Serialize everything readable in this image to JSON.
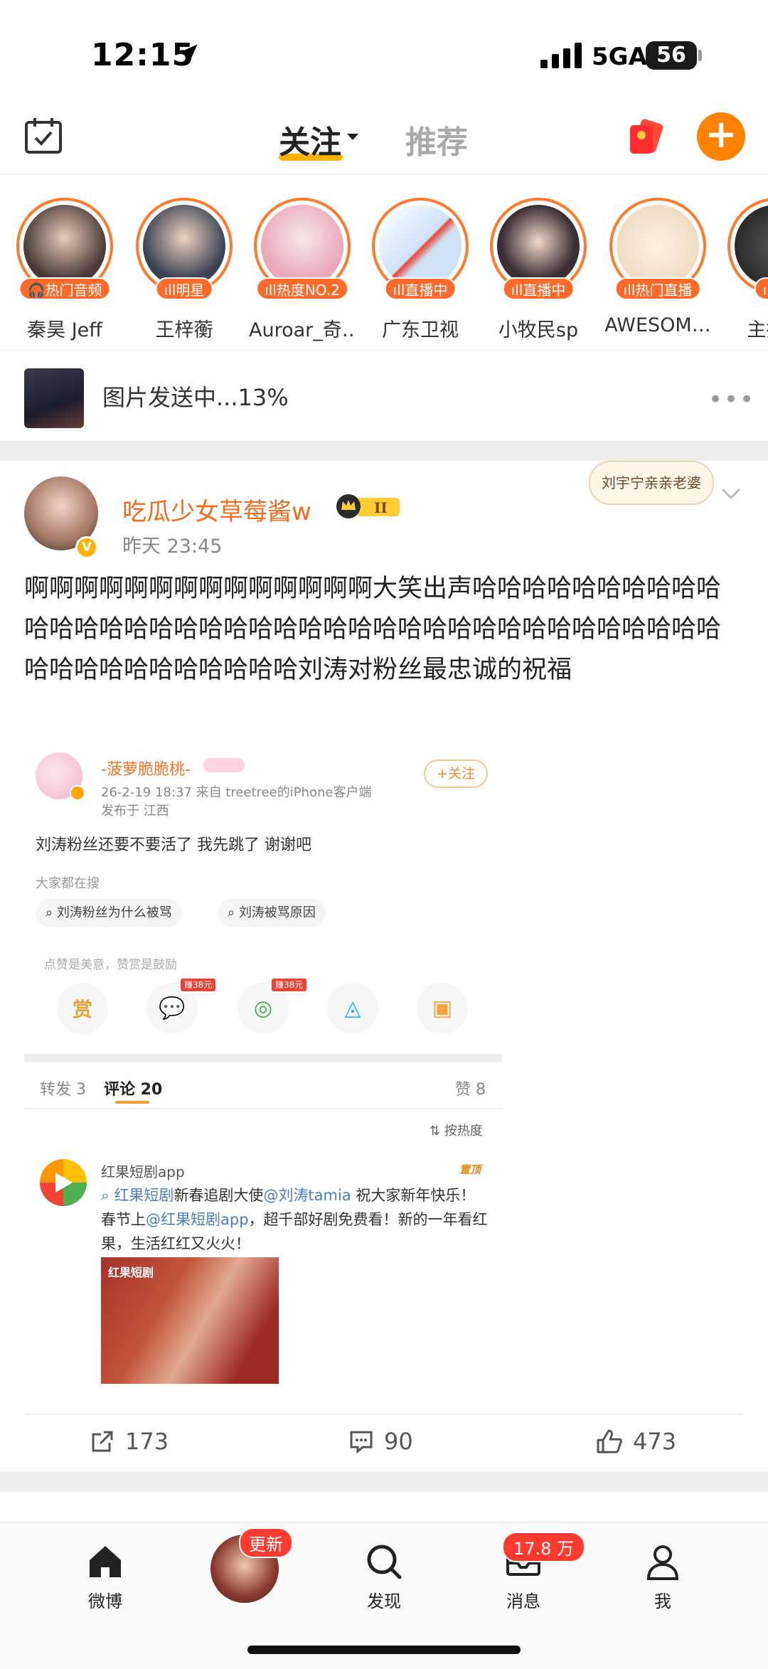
{
  "status_bar": {
    "time": "12:15",
    "network": "5GA",
    "battery": "56"
  },
  "top_nav": {
    "tab_follow": "关注",
    "tab_recommend": "推荐"
  },
  "stories": [
    {
      "name": "秦昊 Jeff",
      "badge": "🎧热门音频",
      "color": "#4a3a3a"
    },
    {
      "name": "王梓蘅",
      "badge": "ıll明星",
      "color": "#3b4250"
    },
    {
      "name": "Auroar_奇…",
      "badge": "ıll热度NO.2",
      "color": "#e9c0cc"
    },
    {
      "name": "广东卫视",
      "badge": "ıll直播中",
      "color": "#dce9f7"
    },
    {
      "name": "小牧民sp",
      "badge": "ıll直播中",
      "color": "#3a2f35"
    },
    {
      "name": "AWESOM…",
      "badge": "ıll热门直播",
      "color": "#f2e4cf"
    },
    {
      "name": "主持人",
      "badge": "ıll直",
      "color": "#2b2b2b"
    }
  ],
  "upload": {
    "text": "图片发送中...13%",
    "more": "•••"
  },
  "post": {
    "author": "吃瓜少女草莓酱w",
    "time": "昨天 23:45",
    "sticker": "刘宇宁亲亲老婆",
    "text": "啊啊啊啊啊啊啊啊啊啊啊啊啊啊大笑出声哈哈哈哈哈哈哈哈哈哈哈哈哈哈哈哈哈哈哈哈哈哈哈哈哈哈哈哈哈哈哈哈哈哈哈哈哈哈哈哈哈哈哈哈哈哈哈哈哈刘涛对粉丝最忠诚的祝福",
    "embed": {
      "name": "-菠萝脆脆桃-",
      "follow": "+关注",
      "meta": "26-2-19 18:37  来自 treetree的iPhone客户端",
      "location": "发布于 江西",
      "body": "刘涛粉丝还要不要活了 我先跳了 谢谢吧",
      "hot_label": "大家都在搜",
      "chips": [
        "刘涛粉丝为什么被骂",
        "刘涛被骂原因"
      ],
      "like_hint": "点赞是美意，赞赏是鼓励",
      "reward_label": "赏",
      "share_tag": "赚38元",
      "tabs": {
        "repost": "转发 3",
        "comment": "评论 20",
        "like": "赞 8"
      },
      "sort": "按热度",
      "comment": {
        "name": "红果短剧app",
        "tag": "置顶",
        "part1": "红果短剧",
        "part2": "新春追剧大使",
        "part3": "@刘涛tamia",
        "part4": " 祝大家新年快乐！春节上",
        "part5": "@红果短剧app",
        "part6": "，超千部好剧免费看！新的一年看红果，生活红红又火火！",
        "image_logo": "红果短剧"
      }
    },
    "actions": {
      "repost": "173",
      "comment": "90",
      "like": "473"
    }
  },
  "tab_bar": {
    "home": "微博",
    "center_badge": "更新",
    "discover": "发现",
    "messages": "消息",
    "messages_badge": "17.8 万",
    "me": "我"
  },
  "colors": {
    "accent": "#ff8200",
    "story_ring": "#ff7a2a",
    "name": "#f26a1b"
  }
}
